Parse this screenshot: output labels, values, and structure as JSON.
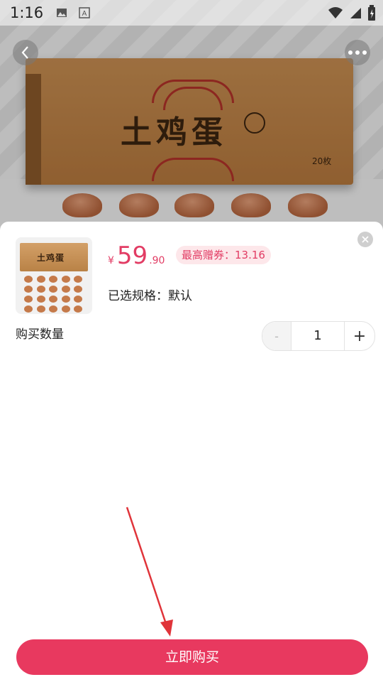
{
  "status_bar": {
    "time": "1:16"
  },
  "product_image": {
    "box_title": "土鸡蛋",
    "box_count": "20枚"
  },
  "sheet": {
    "price_symbol": "¥",
    "price_integer": "59",
    "price_decimal": ".90",
    "coupon_text": "最高赠券：13.16",
    "spec_text": "已选规格：默认",
    "quantity_label": "购买数量",
    "quantity_value": "1",
    "minus_label": "-",
    "plus_label": "+",
    "buy_button_label": "立即购买"
  },
  "colors": {
    "accent": "#e8395f",
    "price": "#e23c64",
    "annotation_arrow": "#e0343a"
  },
  "icons": [
    "image-icon",
    "text-a-icon",
    "wifi-icon",
    "signal-icon",
    "battery-icon",
    "back-arrow-icon",
    "more-dots-icon",
    "close-icon"
  ]
}
